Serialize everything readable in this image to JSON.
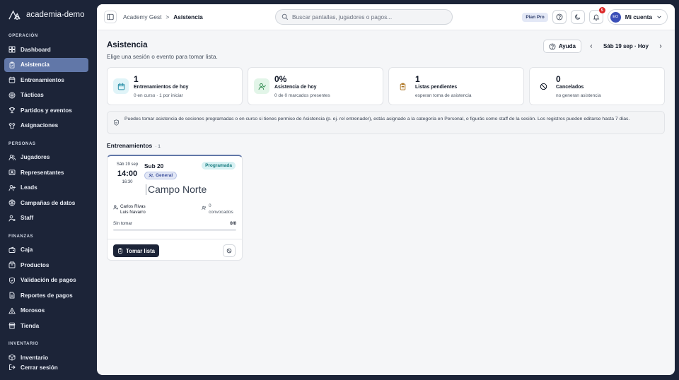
{
  "brand": {
    "name": "academia-demo",
    "icon": "academy-logo-icon"
  },
  "sidebar": {
    "sections": [
      {
        "title": "OPERACIÓN",
        "items": [
          {
            "label": "Dashboard",
            "icon": "grid-icon",
            "active": false
          },
          {
            "label": "Asistencia",
            "icon": "clipboard-check-icon",
            "active": true
          },
          {
            "label": "Entrenamientos",
            "icon": "calendar-icon",
            "active": false
          },
          {
            "label": "Tácticas",
            "icon": "target-icon",
            "active": false
          },
          {
            "label": "Partidos y eventos",
            "icon": "trophy-icon",
            "active": false
          },
          {
            "label": "Asignaciones",
            "icon": "shirt-icon",
            "active": false
          }
        ]
      },
      {
        "title": "PERSONAS",
        "items": [
          {
            "label": "Jugadores",
            "icon": "users-icon",
            "active": false
          },
          {
            "label": "Representantes",
            "icon": "id-card-icon",
            "active": false
          },
          {
            "label": "Leads",
            "icon": "user-plus-icon",
            "active": false
          },
          {
            "label": "Campañas de datos",
            "icon": "megaphone-icon",
            "active": false
          },
          {
            "label": "Staff",
            "icon": "user-cog-icon",
            "active": false
          }
        ]
      },
      {
        "title": "FINANZAS",
        "items": [
          {
            "label": "Caja",
            "icon": "wallet-icon",
            "active": false
          },
          {
            "label": "Productos",
            "icon": "box-icon",
            "active": false
          },
          {
            "label": "Validación de pagos",
            "icon": "shield-check-icon",
            "active": false
          },
          {
            "label": "Reportes de pagos",
            "icon": "file-text-icon",
            "active": false
          },
          {
            "label": "Morosos",
            "icon": "alert-triangle-icon",
            "active": false
          },
          {
            "label": "Tienda",
            "icon": "store-icon",
            "active": false
          }
        ]
      },
      {
        "title": "INVENTARIO",
        "items": [
          {
            "label": "Inventario",
            "icon": "package-icon",
            "active": false
          }
        ]
      }
    ],
    "logout": {
      "label": "Cerrar sesión",
      "icon": "logout-icon"
    }
  },
  "topbar": {
    "breadcrumb": {
      "root": "Academy Gest",
      "separator": ">",
      "current": "Asistencia"
    },
    "search_placeholder": "Buscar pantallas, jugadores o pagos...",
    "plan_badge": "Plan Pro",
    "notification_count": "5",
    "account": {
      "initials": "EO",
      "label": "Mi cuenta"
    }
  },
  "page": {
    "title": "Asistencia",
    "subtitle": "Elige una sesión o evento para tomar lista.",
    "help_label": "Ayuda",
    "date_label": "Sáb 19 sep · Hoy",
    "prev_arrow": "‹",
    "next_arrow": "›"
  },
  "stats": [
    {
      "value": "1",
      "label": "Entrenamientos de hoy",
      "sub": "0 en curso · 1 por iniciar",
      "icon": "calendar-icon",
      "tint": "#e0f4f8",
      "color": "#2a8fa8"
    },
    {
      "value": "0%",
      "label": "Asistencia de hoy",
      "sub": "0 de 0 marcados presentes",
      "icon": "user-check-icon",
      "tint": "#e2f5e8",
      "color": "#2f8a4f"
    },
    {
      "value": "1",
      "label": "Listas pendientes",
      "sub": "esperan toma de asistencia",
      "icon": "clipboard-icon",
      "tint": "#ffffff",
      "color": "#b07a2a"
    },
    {
      "value": "0",
      "label": "Cancelados",
      "sub": "no generan asistencia",
      "icon": "ban-icon",
      "tint": "#ffffff",
      "color": "#111827"
    }
  ],
  "info_banner": "Puedes tomar asistencia de sesiones programadas o en curso si tienes permiso de Asistencia (p. ej. rol entrenador), estás asignado a la categoría en Personal, o figurás como staff de la sesión. Los registros pueden editarse hasta 7 días.",
  "section": {
    "title": "Entrenamientos",
    "count": "· 1"
  },
  "sessions": [
    {
      "date": "Sáb 19 sep",
      "start": "14:00",
      "end": "16:30",
      "category": "Sub 20",
      "status": "Programada",
      "group": "General",
      "venue": "Campo Norte",
      "coaches": [
        "Carlos Rivas",
        "Luis Navarro"
      ],
      "convocados": [
        "0",
        "convocados"
      ],
      "progress_label": "Sin tomar",
      "progress_count": "0/0",
      "progress_fraction": 0,
      "take_label": "Tomar lista"
    }
  ]
}
